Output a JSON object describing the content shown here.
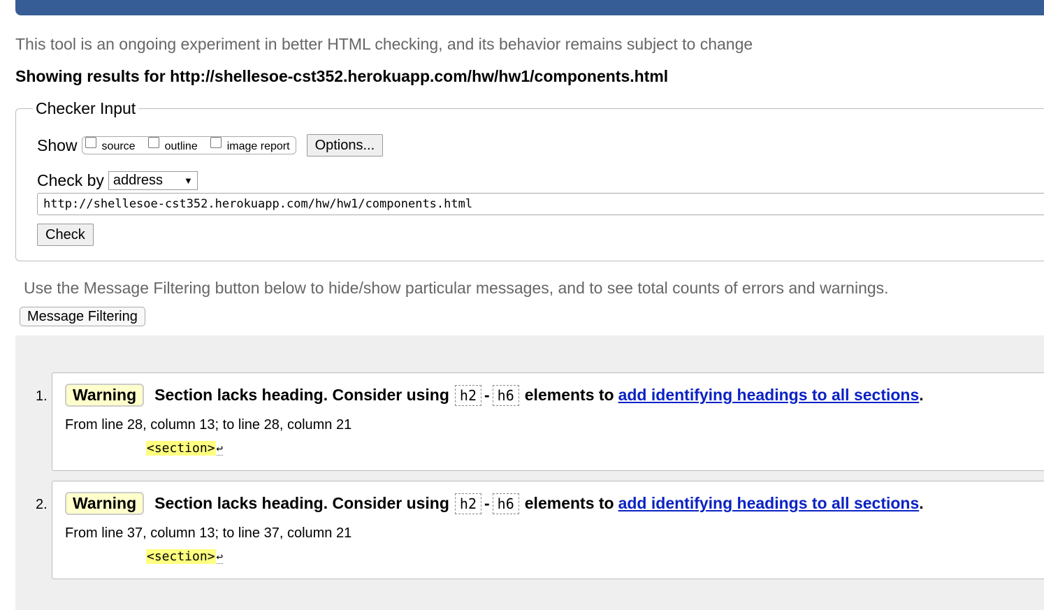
{
  "header": {
    "intro": "This tool is an ongoing experiment in better HTML checking, and its behavior remains subject to change",
    "results_for": "Showing results for http://shellesoe-cst352.herokuapp.com/hw/hw1/components.html"
  },
  "checker": {
    "legend": "Checker Input",
    "show_label": "Show",
    "show_options": [
      {
        "label": "source",
        "checked": false
      },
      {
        "label": "outline",
        "checked": false
      },
      {
        "label": "image report",
        "checked": false
      }
    ],
    "options_button": "Options...",
    "check_by_label": "Check by",
    "check_by_value": "address",
    "url_value": "http://shellesoe-cst352.herokuapp.com/hw/hw1/components.html",
    "check_button": "Check"
  },
  "filtering": {
    "text": "Use the Message Filtering button below to hide/show particular messages, and to see total counts of errors and warnings.",
    "button": "Message Filtering"
  },
  "messages": [
    {
      "number": "1.",
      "type": "Warning",
      "text_before": "Section lacks heading. Consider using",
      "code_a": "h2",
      "separator": "-",
      "code_b": "h6",
      "text_mid": "elements to",
      "link": "add identifying headings to all sections",
      "end": ".",
      "location": "From line 28, column 13; to line 28, column 21",
      "extract": "<section>",
      "linefeed": "↩"
    },
    {
      "number": "2.",
      "type": "Warning",
      "text_before": "Section lacks heading. Consider using",
      "code_a": "h2",
      "separator": "-",
      "code_b": "h6",
      "text_mid": "elements to",
      "link": "add identifying headings to all sections",
      "end": ".",
      "location": "From line 37, column 13; to line 37, column 21",
      "extract": "<section>",
      "linefeed": "↩"
    }
  ],
  "colors": {
    "top_bar": "#365d95",
    "warning_badge_bg": "#ffffcc",
    "highlight": "#ffff80",
    "link": "#0b22c4",
    "results_bg": "#efefef"
  }
}
